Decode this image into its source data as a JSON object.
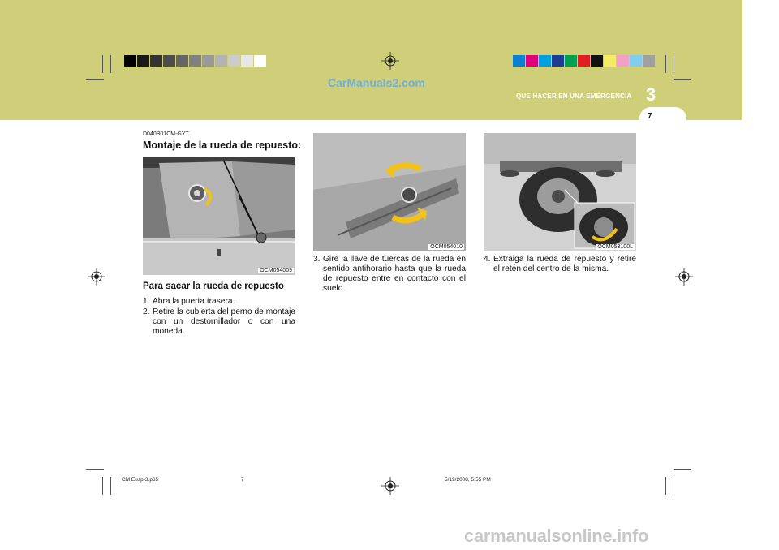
{
  "header": {
    "section_title": "QUE HACER EN UNA EMERGENCIA",
    "chapter_number": "3",
    "page_number": "7",
    "band_color": "#cfcf7a",
    "watermark": "CarManuals2.com"
  },
  "colorbars": {
    "left": [
      "#000000",
      "#1a1a1a",
      "#333333",
      "#4d4d4d",
      "#666666",
      "#808080",
      "#999999",
      "#b3b3b3",
      "#cccccc",
      "#e6e6e6",
      "#ffffff"
    ],
    "right": [
      "#0b7fd4",
      "#e0007a",
      "#00a0e0",
      "#1c3c96",
      "#00a050",
      "#e02020",
      "#111111",
      "#f5ec64",
      "#f2a0c4",
      "#80cdf0",
      "#a0a0a0"
    ]
  },
  "section": {
    "code": "D040B01CM-GYT",
    "heading": "Montaje de la rueda de repuesto:"
  },
  "figures": [
    {
      "caption": "OCM054009",
      "icon": "trunk-floor-bolt-photo"
    },
    {
      "caption": "OCM054010",
      "icon": "wheel-wrench-rotate-photo"
    },
    {
      "caption": "OCM053100L",
      "icon": "spare-wheel-photo"
    }
  ],
  "procedure": {
    "subheading": "Para sacar la rueda de repuesto",
    "steps": [
      {
        "num": "1.",
        "text": "Abra la puerta trasera."
      },
      {
        "num": "2.",
        "text": "Retire la cubierta del perno de montaje con un destornillador o con una moneda."
      },
      {
        "num": "3.",
        "text": "Gire la llave de tuercas de la rueda en sentido antihorario hasta que la rueda de repuesto entre en contacto con el suelo."
      },
      {
        "num": "4.",
        "text": "Extraiga la rueda de repuesto y retire el retén del centro de la misma."
      }
    ]
  },
  "footer": {
    "file": "CM Eusp-3.p65",
    "page": "7",
    "datetime": "5/19/2008, 5:55 PM"
  },
  "site_watermark": "carmanualsonline.info"
}
